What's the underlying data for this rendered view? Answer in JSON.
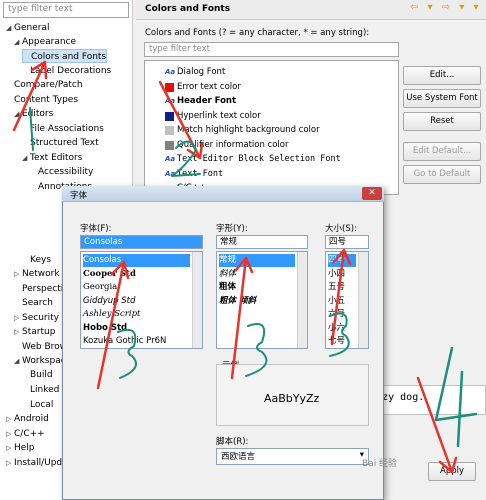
{
  "left": {
    "filter_placeholder": "type filter text",
    "tree": [
      {
        "label": "General",
        "twisty": "◢"
      },
      {
        "label": "Appearance",
        "twisty": "◢"
      },
      {
        "label": "Colors and Fonts",
        "twisty": ""
      },
      {
        "label": "Label Decorations",
        "twisty": ""
      },
      {
        "label": "Compare/Patch",
        "twisty": ""
      },
      {
        "label": "Content Types",
        "twisty": ""
      },
      {
        "label": "Editors",
        "twisty": "◢"
      },
      {
        "label": "File Associations",
        "twisty": ""
      },
      {
        "label": "Structured Text",
        "twisty": ""
      },
      {
        "label": "Text Editors",
        "twisty": "◢"
      },
      {
        "label": "Accessibility",
        "twisty": ""
      },
      {
        "label": "Annotations",
        "twisty": ""
      },
      {
        "label": "Keys",
        "twisty": ""
      },
      {
        "label": "Network",
        "twisty": "▷"
      },
      {
        "label": "Perspectives",
        "twisty": ""
      },
      {
        "label": "Search",
        "twisty": ""
      },
      {
        "label": "Security",
        "twisty": "▷"
      },
      {
        "label": "Startup",
        "twisty": "▷"
      },
      {
        "label": "Web Browser",
        "twisty": ""
      },
      {
        "label": "Workspace",
        "twisty": "◢"
      },
      {
        "label": "Build",
        "twisty": ""
      },
      {
        "label": "Linked",
        "twisty": ""
      },
      {
        "label": "Local",
        "twisty": ""
      },
      {
        "label": "Android",
        "twisty": "▷"
      },
      {
        "label": "C/C++",
        "twisty": "▷"
      },
      {
        "label": "Help",
        "twisty": "▷"
      },
      {
        "label": "Install/Update",
        "twisty": "▷"
      }
    ]
  },
  "right": {
    "title": "Colors and Fonts",
    "nav_arrows": "⇦ ▾ ⇨ ▾ ▾",
    "description": "Colors and Fonts (? = any character, * = any string):",
    "filter_placeholder": "type filter text",
    "font_items": [
      {
        "label": "Dialog Font",
        "kind": "font"
      },
      {
        "label": "Error text color",
        "kind": "color",
        "color": "#e01010"
      },
      {
        "label": "Header Font",
        "kind": "font-bold"
      },
      {
        "label": "Hyperlink text color",
        "kind": "color",
        "color": "#10208a"
      },
      {
        "label": "Match highlight background color",
        "kind": "color",
        "color": "#c0c0c0"
      },
      {
        "label": "Qualifier information color",
        "kind": "color",
        "color": "#808080"
      },
      {
        "label": "Text Editor Block Selection Font",
        "kind": "mono"
      },
      {
        "label": "Text Font",
        "kind": "mono"
      },
      {
        "label": "C/C++",
        "kind": "folder"
      }
    ],
    "buttons": {
      "edit": "Edit...",
      "use_system_font": "Use System Font",
      "reset": "Reset",
      "edit_default": "Edit Default...",
      "go_to_default": "Go to Default",
      "apply": "Apply"
    },
    "preview_text": "he lazy dog."
  },
  "dialog": {
    "title": "字体",
    "close": "✕",
    "font_label": "字体(F):",
    "font_value": "Consolas",
    "fonts": [
      "Consolas",
      "Cooper Std",
      "Georgia",
      "Giddyup Std",
      "Ashley Script",
      "Hobo Std",
      "Kozuka Gothic Pr6N"
    ],
    "style_label": "字形(Y):",
    "style_value": "常规",
    "styles": [
      "常规",
      "斜体",
      "粗体",
      "粗体 倾斜"
    ],
    "size_label": "大小(S):",
    "size_value": "四号",
    "sizes": [
      "四号",
      "小四",
      "五号",
      "小五",
      "六号",
      "小六",
      "七号"
    ],
    "sample_label": "示例",
    "sample_text": "AaBbYyZz",
    "script_label": "脚本(R):",
    "script_value": "西欧语言"
  },
  "watermark": "Bai 经验"
}
